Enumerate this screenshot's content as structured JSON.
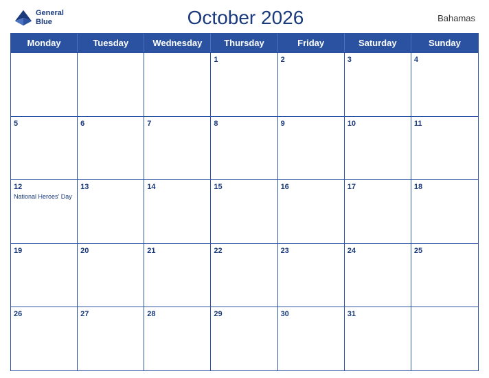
{
  "header": {
    "logo": {
      "line1": "General",
      "line2": "Blue"
    },
    "title": "October 2026",
    "country": "Bahamas"
  },
  "dayHeaders": [
    "Monday",
    "Tuesday",
    "Wednesday",
    "Thursday",
    "Friday",
    "Saturday",
    "Sunday"
  ],
  "weeks": [
    [
      {
        "day": "",
        "empty": true
      },
      {
        "day": "",
        "empty": true
      },
      {
        "day": "",
        "empty": true
      },
      {
        "day": "1"
      },
      {
        "day": "2"
      },
      {
        "day": "3"
      },
      {
        "day": "4"
      }
    ],
    [
      {
        "day": "5"
      },
      {
        "day": "6"
      },
      {
        "day": "7"
      },
      {
        "day": "8"
      },
      {
        "day": "9"
      },
      {
        "day": "10"
      },
      {
        "day": "11"
      }
    ],
    [
      {
        "day": "12",
        "holiday": "National Heroes' Day"
      },
      {
        "day": "13"
      },
      {
        "day": "14"
      },
      {
        "day": "15"
      },
      {
        "day": "16"
      },
      {
        "day": "17"
      },
      {
        "day": "18"
      }
    ],
    [
      {
        "day": "19"
      },
      {
        "day": "20"
      },
      {
        "day": "21"
      },
      {
        "day": "22"
      },
      {
        "day": "23"
      },
      {
        "day": "24"
      },
      {
        "day": "25"
      }
    ],
    [
      {
        "day": "26"
      },
      {
        "day": "27"
      },
      {
        "day": "28"
      },
      {
        "day": "29"
      },
      {
        "day": "30"
      },
      {
        "day": "31"
      },
      {
        "day": "",
        "empty": true
      }
    ]
  ]
}
